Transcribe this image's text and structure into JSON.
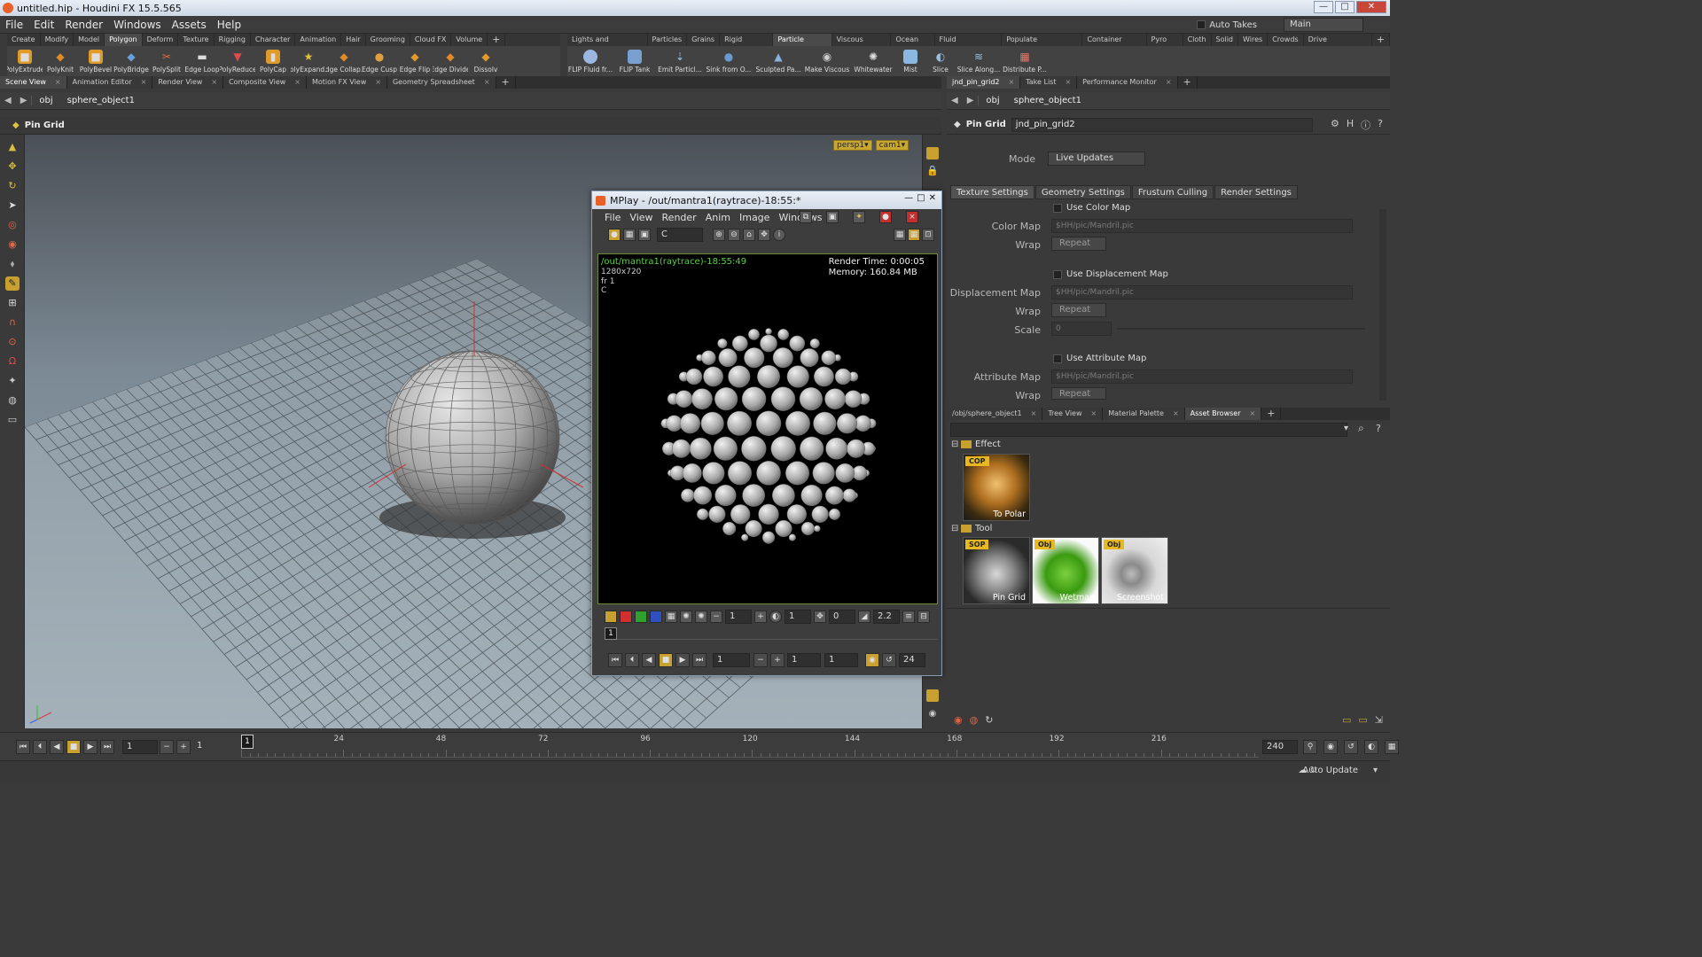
{
  "window": {
    "title": "untitled.hip - Houdini FX 15.5.565",
    "win_buttons": [
      "—",
      "□",
      "✕"
    ]
  },
  "menubar": {
    "items": [
      "File",
      "Edit",
      "Render",
      "Windows",
      "Assets",
      "Help"
    ],
    "auto_takes": "Auto Takes",
    "desktop": "Main"
  },
  "shelf_left": {
    "tabs": [
      "Create",
      "Modify",
      "Model",
      "Polygon",
      "Deform",
      "Texture",
      "Rigging",
      "Character",
      "Animation",
      "Hair",
      "Grooming",
      "Cloud FX",
      "Volume"
    ],
    "active_tab": "Polygon",
    "tools": [
      "PolyExtrude",
      "PolyKnit",
      "PolyBevel",
      "PolyBridge",
      "PolySplit",
      "Edge Loop",
      "PolyReduce",
      "PolyCap",
      "PolyExpand...",
      "Edge Collap...",
      "Edge Cusp",
      "Edge Flip",
      "Edge Divide",
      "Dissolv"
    ]
  },
  "shelf_right": {
    "tabs": [
      "Lights and Cameras",
      "Particles",
      "Grains",
      "Rigid Bodies",
      "Particle Fluids",
      "Viscous Fluids",
      "Ocean FX",
      "Fluid Containers",
      "Populate Containers",
      "Container Tools",
      "Pyro FX",
      "Cloth",
      "Solid",
      "Wires",
      "Crowds",
      "Drive Simulation"
    ],
    "active_tab": "Particle Fluids",
    "tools": [
      "FLIP Fluid fr...",
      "FLIP Tank",
      "Emit Particl...",
      "Sink from O...",
      "Sculpted Pa...",
      "Make Viscous",
      "Whitewater",
      "Mist",
      "Slice",
      "Slice Along...",
      "Distribute P..."
    ]
  },
  "left_pane": {
    "tabs": [
      "Scene View",
      "Animation Editor",
      "Render View",
      "Composite View",
      "Motion FX View",
      "Geometry Spreadsheet"
    ],
    "path": [
      "obj",
      "sphere_object1"
    ],
    "operation": "Pin Grid",
    "camera_menus": [
      "persp1▾",
      "cam1▾"
    ]
  },
  "mplay": {
    "title": "MPlay - /out/mantra1(raytrace)-18:55:*",
    "menu": [
      "File",
      "View",
      "Render",
      "Anim",
      "Image",
      "Windows"
    ],
    "channel": "C",
    "overlay": {
      "name": "/out/mantra1(raytrace)-18:55:49",
      "resolution": "1280x720",
      "frame": "fr 1",
      "channel": "C",
      "render_time": "Render Time: 0:00:05",
      "memory": "Memory:   160.84 MB"
    },
    "controls": {
      "f1": "1",
      "f2": "1",
      "f3": "0",
      "gamma": "2.2"
    },
    "frame_marker": "1",
    "playbar": {
      "start": "1",
      "current": "1",
      "end": "1",
      "fps": "24"
    }
  },
  "params_pane": {
    "tabs": [
      "jnd_pin_grid2",
      "Take List",
      "Performance Monitor"
    ],
    "path": [
      "obj",
      "sphere_object1"
    ],
    "node_type": "Pin Grid",
    "node_name": "jnd_pin_grid2",
    "mode_label": "Mode",
    "mode_value": "Live Updates",
    "section_tabs": [
      "Texture Settings",
      "Geometry Settings",
      "Frustum Culling",
      "Render Settings"
    ],
    "color_map": {
      "toggle": "Use Color Map",
      "label": "Color Map",
      "value": "$HH/pic/Mandril.pic",
      "wrap_label": "Wrap",
      "wrap": "Repeat"
    },
    "disp_map": {
      "toggle": "Use Displacement Map",
      "label": "Displacement Map",
      "value": "$HH/pic/Mandril.pic",
      "wrap_label": "Wrap",
      "wrap": "Repeat",
      "scale_label": "Scale",
      "scale": "0"
    },
    "attr_map": {
      "toggle": "Use Attribute Map",
      "label": "Attribute Map",
      "value": "$HH/pic/Mandril.pic",
      "wrap_label": "Wrap",
      "wrap": "Repeat"
    }
  },
  "assets_pane": {
    "tabs": [
      "/obj/sphere_object1",
      "Tree View",
      "Material Palette",
      "Asset Browser"
    ],
    "groups": [
      {
        "name": "Effect",
        "items": [
          {
            "badge": "COP",
            "label": "To Polar"
          }
        ]
      },
      {
        "name": "Tool",
        "items": [
          {
            "badge": "SOP",
            "label": "Pin Grid"
          },
          {
            "badge": "Obj",
            "label": "Wetmap"
          },
          {
            "badge": "Obj",
            "label": "Screenshot"
          }
        ]
      }
    ]
  },
  "timeline": {
    "frame_start": "1",
    "frame_step": "1",
    "ticks": [
      "1",
      "24",
      "48",
      "72",
      "96",
      "120",
      "144",
      "168",
      "192",
      "216"
    ],
    "current": "1",
    "end": "240",
    "auto_update": "Auto Update"
  }
}
